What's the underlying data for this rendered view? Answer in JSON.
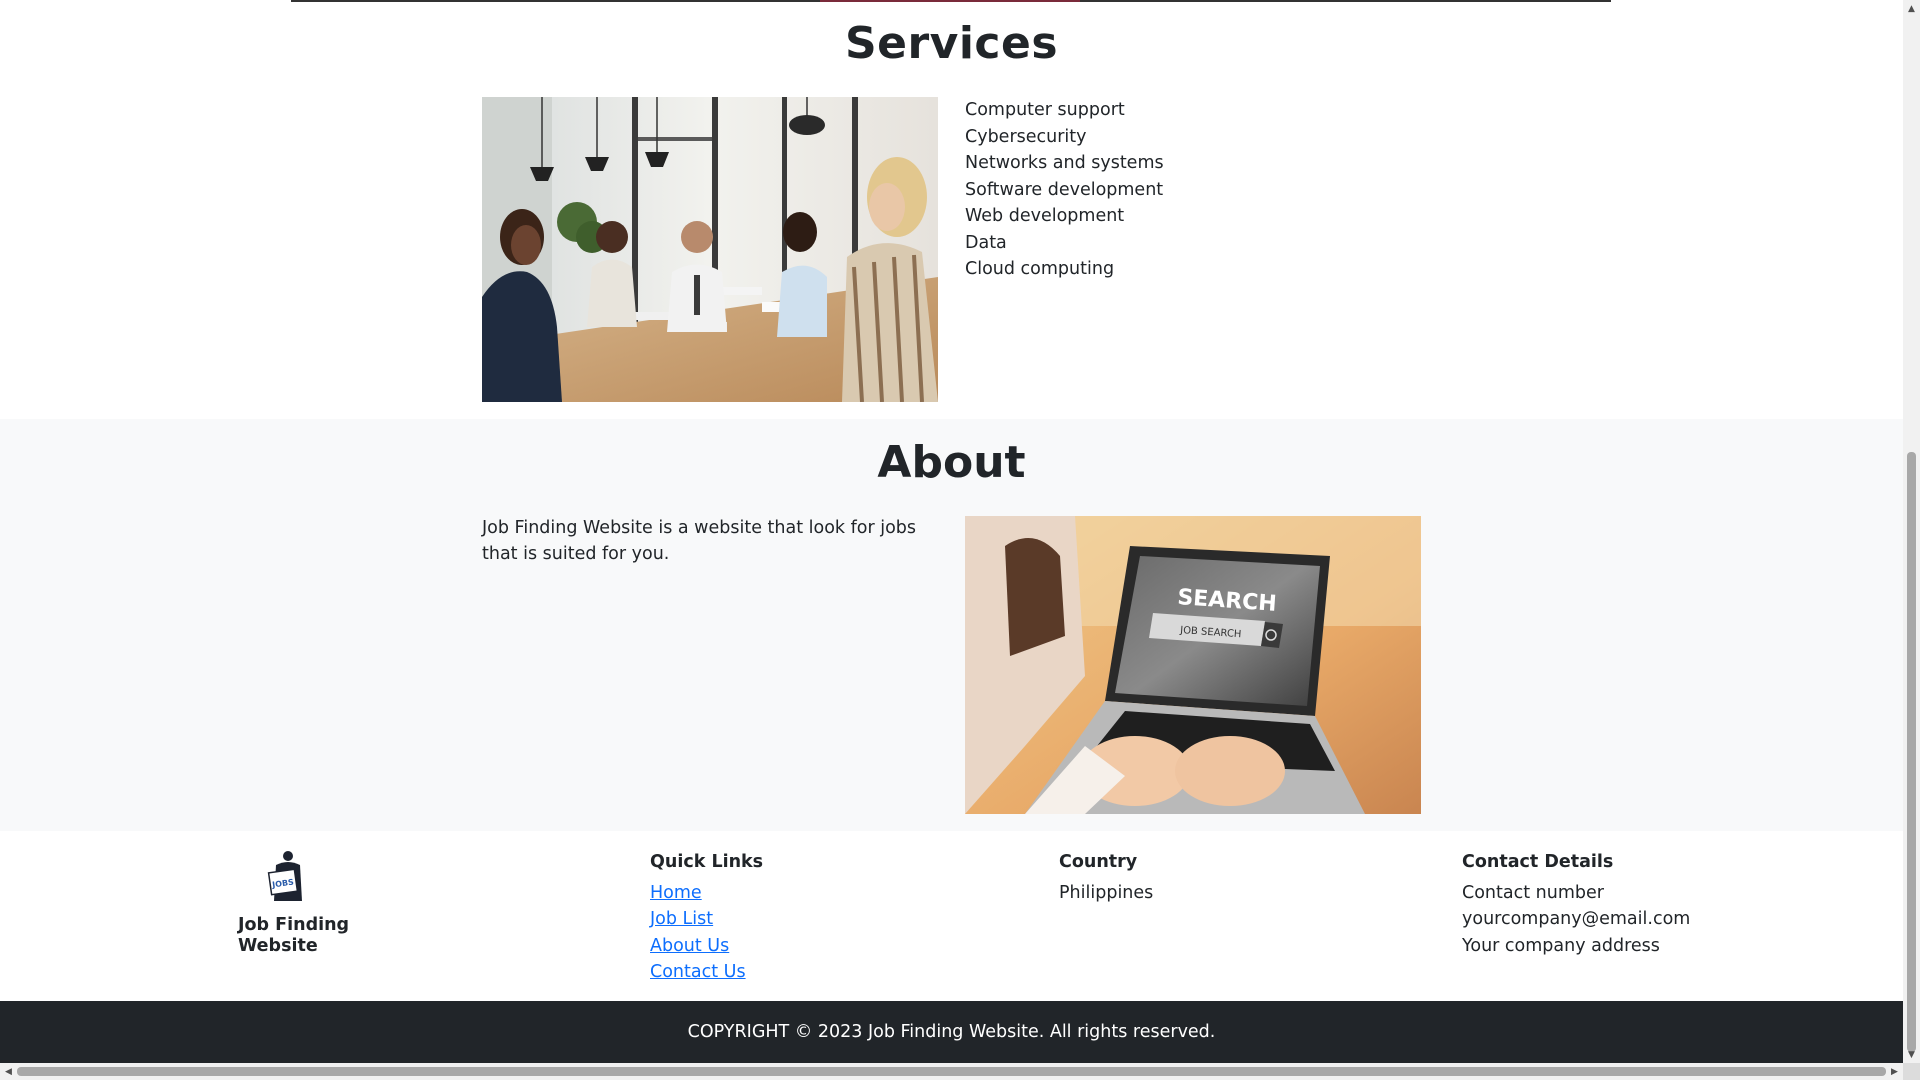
{
  "services": {
    "title": "Services",
    "items": [
      "Computer support",
      "Cybersecurity",
      "Networks and systems",
      "Software development",
      "Web development",
      "Data",
      "Cloud computing"
    ]
  },
  "about": {
    "title": "About",
    "description": "Job Finding Website is a website that look for jobs that is suited for you.",
    "image_text": {
      "headline": "SEARCH",
      "field": "JOB SEARCH"
    }
  },
  "footer": {
    "brand": {
      "name": "Job Finding Website",
      "logo_text": "JOBS"
    },
    "quick_links": {
      "title": "Quick Links",
      "links": [
        "Home",
        "Job List",
        "About Us",
        "Contact Us"
      ]
    },
    "country": {
      "title": "Country",
      "value": "Philippines"
    },
    "contact": {
      "title": "Contact Details",
      "lines": [
        "Contact number",
        "yourcompany@email.com",
        "Your company address"
      ]
    },
    "copyright": "COPYRIGHT © 2023 Job Finding Website. All rights reserved."
  },
  "icons": {
    "scroll_up": "triangle-up",
    "scroll_down": "triangle-down",
    "scroll_left": "triangle-left",
    "scroll_right": "triangle-right"
  },
  "colors": {
    "link": "#0d6efd",
    "footer_dark": "#212529",
    "about_bg": "#f8f9fa"
  }
}
